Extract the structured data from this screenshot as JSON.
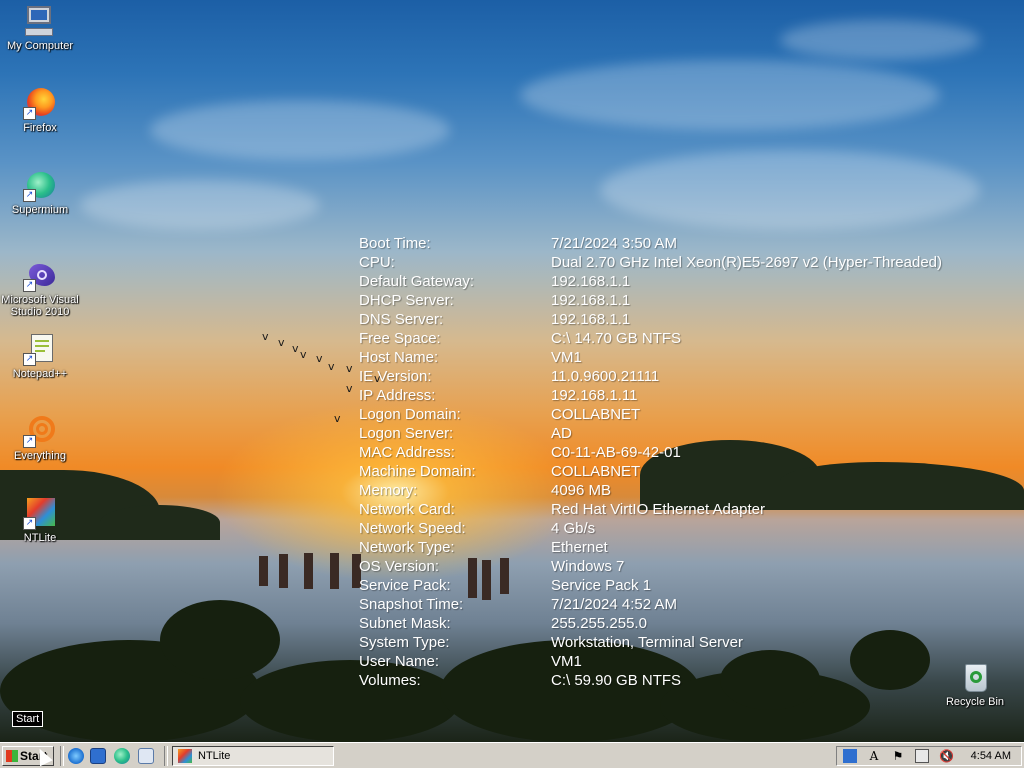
{
  "desktop": {
    "icons": [
      {
        "label": "My Computer",
        "icon": "computer-icon"
      },
      {
        "label": "Firefox",
        "icon": "firefox-icon"
      },
      {
        "label": "Supermium",
        "icon": "supermium-icon"
      },
      {
        "label": "Microsoft Visual Studio 2010",
        "icon": "visual-studio-icon"
      },
      {
        "label": "Notepad++",
        "icon": "notepadpp-icon"
      },
      {
        "label": "Everything",
        "icon": "everything-icon"
      },
      {
        "label": "NTLite",
        "icon": "ntlite-icon"
      },
      {
        "label": "Recycle Bin",
        "icon": "recycle-bin-icon"
      }
    ],
    "start_tooltip": "Start"
  },
  "bginfo": {
    "rows": [
      {
        "key": "Boot Time:",
        "value": "7/21/2024 3:50 AM"
      },
      {
        "key": "CPU:",
        "value": "Dual 2.70 GHz Intel Xeon(R)E5-2697 v2 (Hyper-Threaded)"
      },
      {
        "key": "Default Gateway:",
        "value": "192.168.1.1"
      },
      {
        "key": "DHCP Server:",
        "value": "192.168.1.1"
      },
      {
        "key": "DNS Server:",
        "value": "192.168.1.1"
      },
      {
        "key": "Free Space:",
        "value": "C:\\ 14.70 GB NTFS"
      },
      {
        "key": "Host Name:",
        "value": "VM1"
      },
      {
        "key": "IE Version:",
        "value": "11.0.9600.21111"
      },
      {
        "key": "IP Address:",
        "value": "192.168.1.11"
      },
      {
        "key": "Logon Domain:",
        "value": "COLLABNET"
      },
      {
        "key": "Logon Server:",
        "value": "AD"
      },
      {
        "key": "MAC Address:",
        "value": "C0-11-AB-69-42-01"
      },
      {
        "key": "Machine Domain:",
        "value": "COLLABNET"
      },
      {
        "key": "Memory:",
        "value": "4096 MB"
      },
      {
        "key": "Network Card:",
        "value": "Red Hat VirtIO Ethernet Adapter"
      },
      {
        "key": "Network Speed:",
        "value": "4 Gb/s"
      },
      {
        "key": "Network Type:",
        "value": "Ethernet"
      },
      {
        "key": "OS Version:",
        "value": "Windows 7"
      },
      {
        "key": "Service Pack:",
        "value": "Service Pack 1"
      },
      {
        "key": "Snapshot Time:",
        "value": "7/21/2024 4:52 AM"
      },
      {
        "key": "Subnet Mask:",
        "value": "255.255.255.0"
      },
      {
        "key": "System Type:",
        "value": "Workstation, Terminal Server"
      },
      {
        "key": "User Name:",
        "value": "VM1"
      },
      {
        "key": "Volumes:",
        "value": "C:\\ 59.90 GB NTFS"
      }
    ]
  },
  "taskbar": {
    "start_label": "Start",
    "quick_launch": [
      "ie-icon",
      "desktop-icon",
      "supermium-icon",
      "explorer-icon"
    ],
    "tasks": [
      {
        "label": "NTLite",
        "icon": "ntlite-icon"
      }
    ],
    "tray_icons": [
      "windows-icon",
      "font-icon",
      "flag-icon",
      "network-icon",
      "volume-muted-icon"
    ],
    "clock": "4:54 AM"
  }
}
